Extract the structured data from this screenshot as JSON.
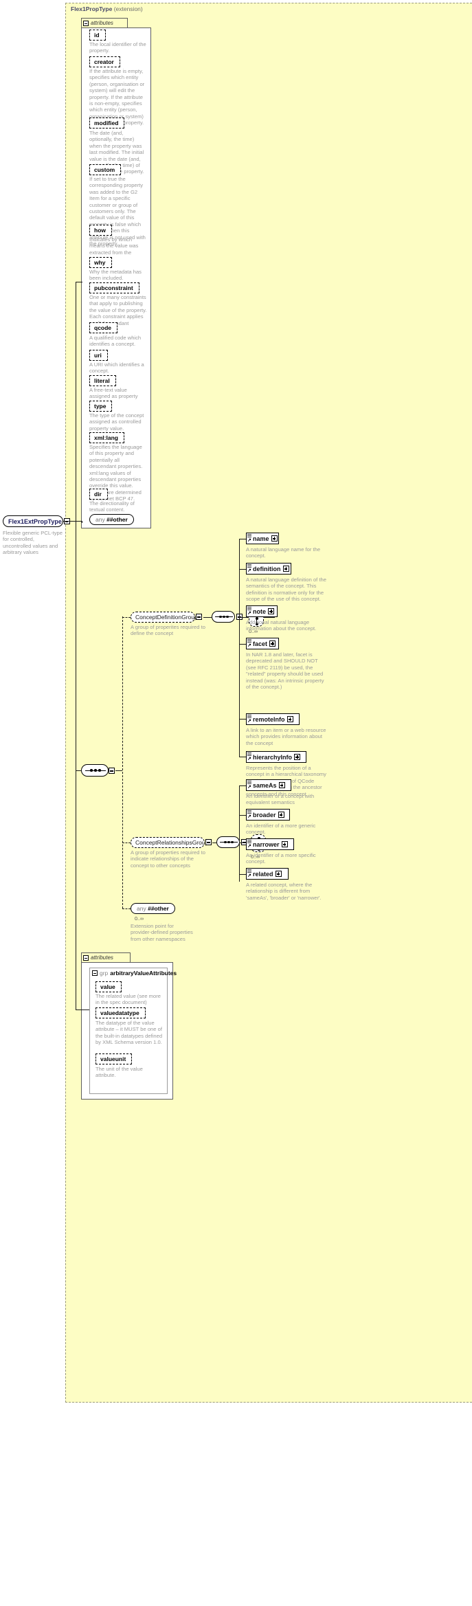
{
  "diagram": {
    "title": "Flex1PropType",
    "title_suffix": "(extension)",
    "attributes_label": "attributes",
    "type_ref": {
      "name": "Flex1ExtPropType",
      "description": "Flexible generic PCL-type for controlled, uncontrolled values and arbitrary values"
    },
    "attributes": [
      {
        "name": "id",
        "description": "The local identifier of the property."
      },
      {
        "name": "creator",
        "description": "If the attribute is empty, specifies which entity (person, organisation or system) will edit the property. If the attribute is non-empty, specifies which entity (person, organisation or system) has edited the property."
      },
      {
        "name": "modified",
        "description": "The date (and, optionally, the time) when the property was last modified. The initial value is the date (and, optionally, the time) of creation of the property."
      },
      {
        "name": "custom",
        "description": "If set to true the corresponding property was added to the G2 Item for a specific customer or group of customers only. The default value of this property is false which applies when this attribute is not used with the property."
      },
      {
        "name": "how",
        "description": "Indicates by which means the value was extracted from the content."
      },
      {
        "name": "why",
        "description": "Why the metadata has been included."
      },
      {
        "name": "pubconstraint",
        "description": "One or many constraints that apply to publishing the value of the property. Each constraint applies to all descendant elements."
      },
      {
        "name": "qcode",
        "description": "A qualified code which identifies a concept."
      },
      {
        "name": "uri",
        "description": "A URI which identifies a concept."
      },
      {
        "name": "literal",
        "description": "A free-text value assigned as property value."
      },
      {
        "name": "type",
        "description": "The type of the concept assigned as controlled property value."
      },
      {
        "name": "xml:lang",
        "description": "Specifies the language of this property and potentially all descendant properties. xml:lang values of descendant properties override this value. Values are determined by Internet BCP 47."
      },
      {
        "name": "dir",
        "description": "The directionality of textual content."
      }
    ],
    "attributes_any": {
      "keyword": "any",
      "name": "##other"
    },
    "groups": [
      {
        "id": "concept-definition-group",
        "name": "ConceptDefinitionGroup",
        "description": "A group of properites required to define the concept",
        "occurs": "0..∞",
        "elements": [
          {
            "name": "name",
            "description": "A natural language name for the concept."
          },
          {
            "name": "definition",
            "description": "A natural language definition of the semantics of the concept. This definition is normative only for the scope of the use of this concept."
          },
          {
            "name": "note",
            "description": "Additional natural language information about the concept."
          },
          {
            "name": "facet",
            "description": "In NAR 1.8 and later, facet is deprecated and SHOULD NOT (see RFC 2119) be used, the \"related\" property should be used instead (was: An intrinsic property of the concept.)"
          },
          {
            "name": "remoteInfo",
            "description": "A link to an item or a web resource which provides information about the concept"
          },
          {
            "name": "hierarchyInfo",
            "description": "Represents the position of a concept in a hierarchical taxonomy tree by a sequence of QCode tokens representing the ancestor concepts and this concept"
          }
        ]
      },
      {
        "id": "concept-relationships-group",
        "name": "ConceptRelationshipsGroup",
        "description": "A group of properties required to indicate relationships of the concept to other concepts",
        "occurs": "0..∞",
        "elements": [
          {
            "name": "sameAs",
            "description": "An identifier of a concept with equivalent semantics"
          },
          {
            "name": "broader",
            "description": "An identifier of a more generic concept."
          },
          {
            "name": "narrower",
            "description": "An identifier of a more specific concept."
          },
          {
            "name": "related",
            "description": "A related concept, where the relationship is different from 'sameAs', 'broader' or 'narrower'."
          }
        ]
      }
    ],
    "content_any": {
      "keyword": "any",
      "name": "##other",
      "occurs": "0..∞",
      "description": "Extension point for provider-defined properties from other namespaces"
    },
    "bottom_attributes": {
      "label": "attributes",
      "group_keyword": "grp",
      "group_name": "arbitraryValueAttributes",
      "items": [
        {
          "name": "value",
          "description": "The related value (see more in the spec document)"
        },
        {
          "name": "valuedatatype",
          "description": "The datatype of the value attribute – it MUST be one of the built-in datatypes defined by XML Schema version 1.0."
        },
        {
          "name": "valueunit",
          "description": "The unit of the value attribute."
        }
      ]
    },
    "colors": {
      "panel_background": "#fdfdc4",
      "description_text": "#9a9a9a",
      "title_text": "#4b4b6b",
      "line": "#1a1a1a"
    }
  }
}
